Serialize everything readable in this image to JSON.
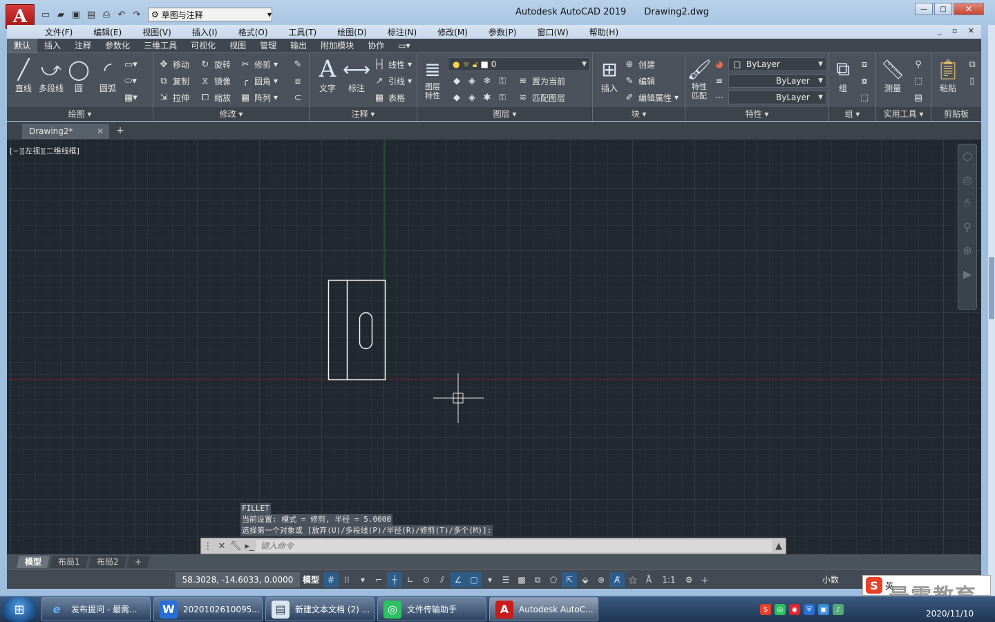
{
  "window": {
    "app_title": "Autodesk AutoCAD 2019",
    "file_name": "Drawing2.dwg",
    "app_button": "A",
    "workspace": "草图与注释",
    "minimize": "—",
    "maximize": "□",
    "close": "✕"
  },
  "menu": [
    "文件(F)",
    "编辑(E)",
    "视图(V)",
    "插入(I)",
    "格式(O)",
    "工具(T)",
    "绘图(D)",
    "标注(N)",
    "修改(M)",
    "参数(P)",
    "窗口(W)",
    "帮助(H)"
  ],
  "mdi_controls": "_ ▫ ✕",
  "ribbon_tabs": [
    "默认",
    "插入",
    "注释",
    "参数化",
    "三维工具",
    "可视化",
    "视图",
    "管理",
    "输出",
    "附加模块",
    "协作"
  ],
  "ribbon": {
    "draw": {
      "title": "绘图 ▾",
      "line": "直线",
      "polyline": "多段线",
      "circle": "圆",
      "arc": "圆弧"
    },
    "modify": {
      "title": "修改 ▾",
      "move": "移动",
      "rotate": "旋转",
      "trim": "修剪",
      "copy": "复制",
      "mirror": "镜像",
      "fillet": "圆角",
      "stretch": "拉伸",
      "scale": "缩放",
      "array": "阵列"
    },
    "annotation": {
      "title": "注释 ▾",
      "text": "文字",
      "dimension": "标注",
      "linear": "线性",
      "leader": "引线",
      "table": "表格"
    },
    "layers": {
      "title": "图层 ▾",
      "layer_props": "图层特性",
      "current_layer": "0",
      "make_current": "置为当前",
      "match_layer": "匹配图层"
    },
    "block": {
      "title": "块 ▾",
      "insert": "插入",
      "create": "创建",
      "edit": "编辑",
      "edit_attr": "编辑属性"
    },
    "properties": {
      "title": "特性 ▾",
      "match": "特性匹配",
      "color": "ByLayer",
      "linetype": "ByLayer",
      "lineweight": "ByLayer"
    },
    "groups": {
      "title": "组 ▾",
      "group": "组"
    },
    "utilities": {
      "title": "实用工具 ▾",
      "measure": "测量"
    },
    "clipboard": {
      "title": "剪贴板",
      "paste": "粘贴"
    }
  },
  "doc_tab": {
    "name": "Drawing2*",
    "close": "✕",
    "new": "+"
  },
  "viewport_label": "[−][左视][二维线框]",
  "command_history": [
    "FILLET",
    "当前设置: 模式 = 修剪, 半径 = 5.0000",
    "选择第一个对象或 [放弃(U)/多段线(P)/半径(R)/修剪(T)/多个(M)]:"
  ],
  "command_input": {
    "placeholder": "键入命令"
  },
  "layout_tabs": [
    "模型",
    "布局1",
    "布局2",
    "+"
  ],
  "status": {
    "coords": "58.3028, -14.6033, 0.0000",
    "model": "模型",
    "scale": "1:1",
    "units": "小数"
  },
  "taskbar": {
    "items": [
      "发布提问 - 最需...",
      "2020102610095...",
      "新建文本文档 (2) ...",
      "文件传输助手",
      "Autodesk AutoC..."
    ],
    "date": "2020/11/10"
  },
  "ime": {
    "logo": "S",
    "lang": "英"
  },
  "watermark": "最需教育",
  "colors": {
    "canvas": "#212830",
    "ribbon": "#4b525b",
    "x_axis": "#7a1f28",
    "y_axis": "#1e6a2a"
  }
}
